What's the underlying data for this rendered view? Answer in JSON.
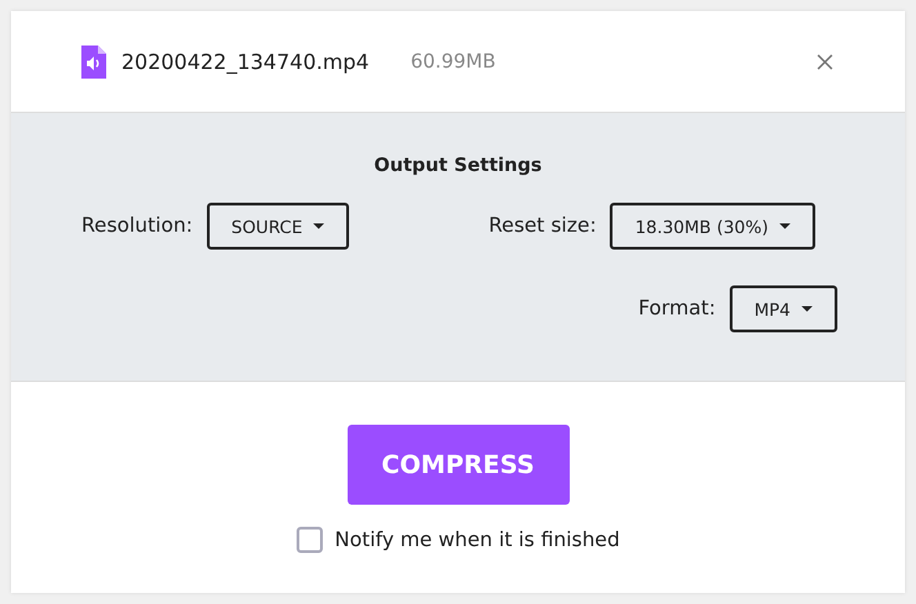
{
  "file": {
    "name": "20200422_134740.mp4",
    "size": "60.99MB"
  },
  "settings": {
    "title": "Output Settings",
    "fields": [
      {
        "label": "Resolution:",
        "value": "SOURCE"
      },
      {
        "label": "Reset size:",
        "value": "18.30MB (30%)"
      },
      {
        "label": "Format:",
        "value": "MP4"
      }
    ]
  },
  "compress_button": "COMPRESS",
  "notify": {
    "label": "Notify me when it is finished",
    "checked": false
  }
}
